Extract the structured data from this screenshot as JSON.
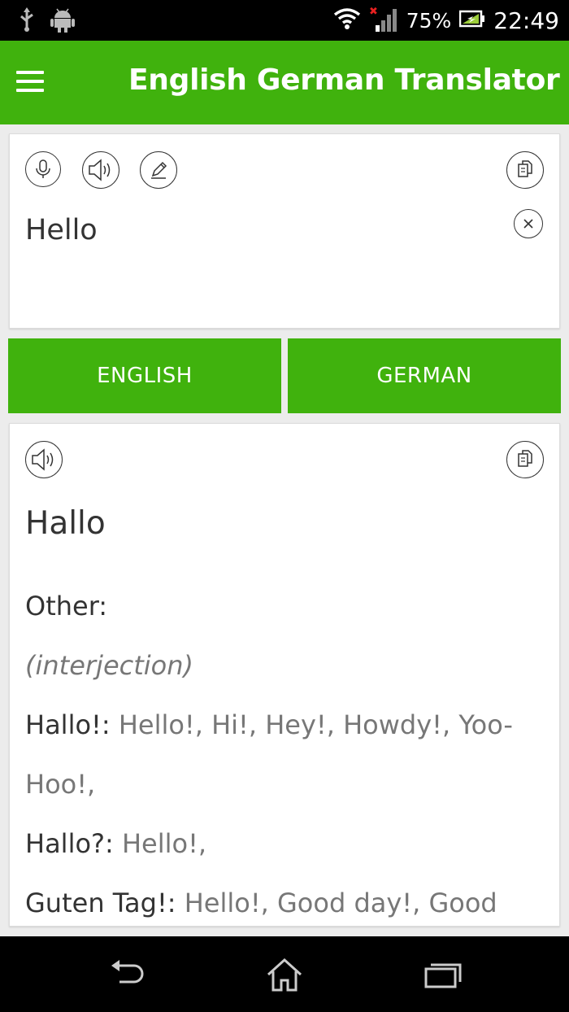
{
  "status_bar": {
    "battery_percent": "75%",
    "time": "22:49"
  },
  "app_bar": {
    "title": "English German Translator"
  },
  "input": {
    "text": "Hello"
  },
  "languages": {
    "source": "ENGLISH",
    "target": "GERMAN"
  },
  "result": {
    "translation": "Hallo",
    "other_label": "Other:",
    "part_of_speech": "(interjection)",
    "entries": [
      {
        "term": "Hallo!:",
        "meanings": " Hello!, Hi!, Hey!, Howdy!, Yoo-Hoo!,"
      },
      {
        "term": "Hallo?:",
        "meanings": " Hello!,"
      },
      {
        "term": "Guten Tag!:",
        "meanings": " Hello!, Good day!, Good"
      }
    ]
  },
  "colors": {
    "accent": "#40b20d",
    "text_primary": "#333333",
    "text_secondary": "#777777"
  },
  "icons": [
    "usb-icon",
    "android-icon",
    "wifi-icon",
    "signal-icon",
    "battery-charging-icon",
    "menu-icon",
    "microphone-icon",
    "speaker-icon",
    "pencil-icon",
    "copy-icon",
    "clear-icon",
    "back-icon",
    "home-icon",
    "recents-icon"
  ]
}
